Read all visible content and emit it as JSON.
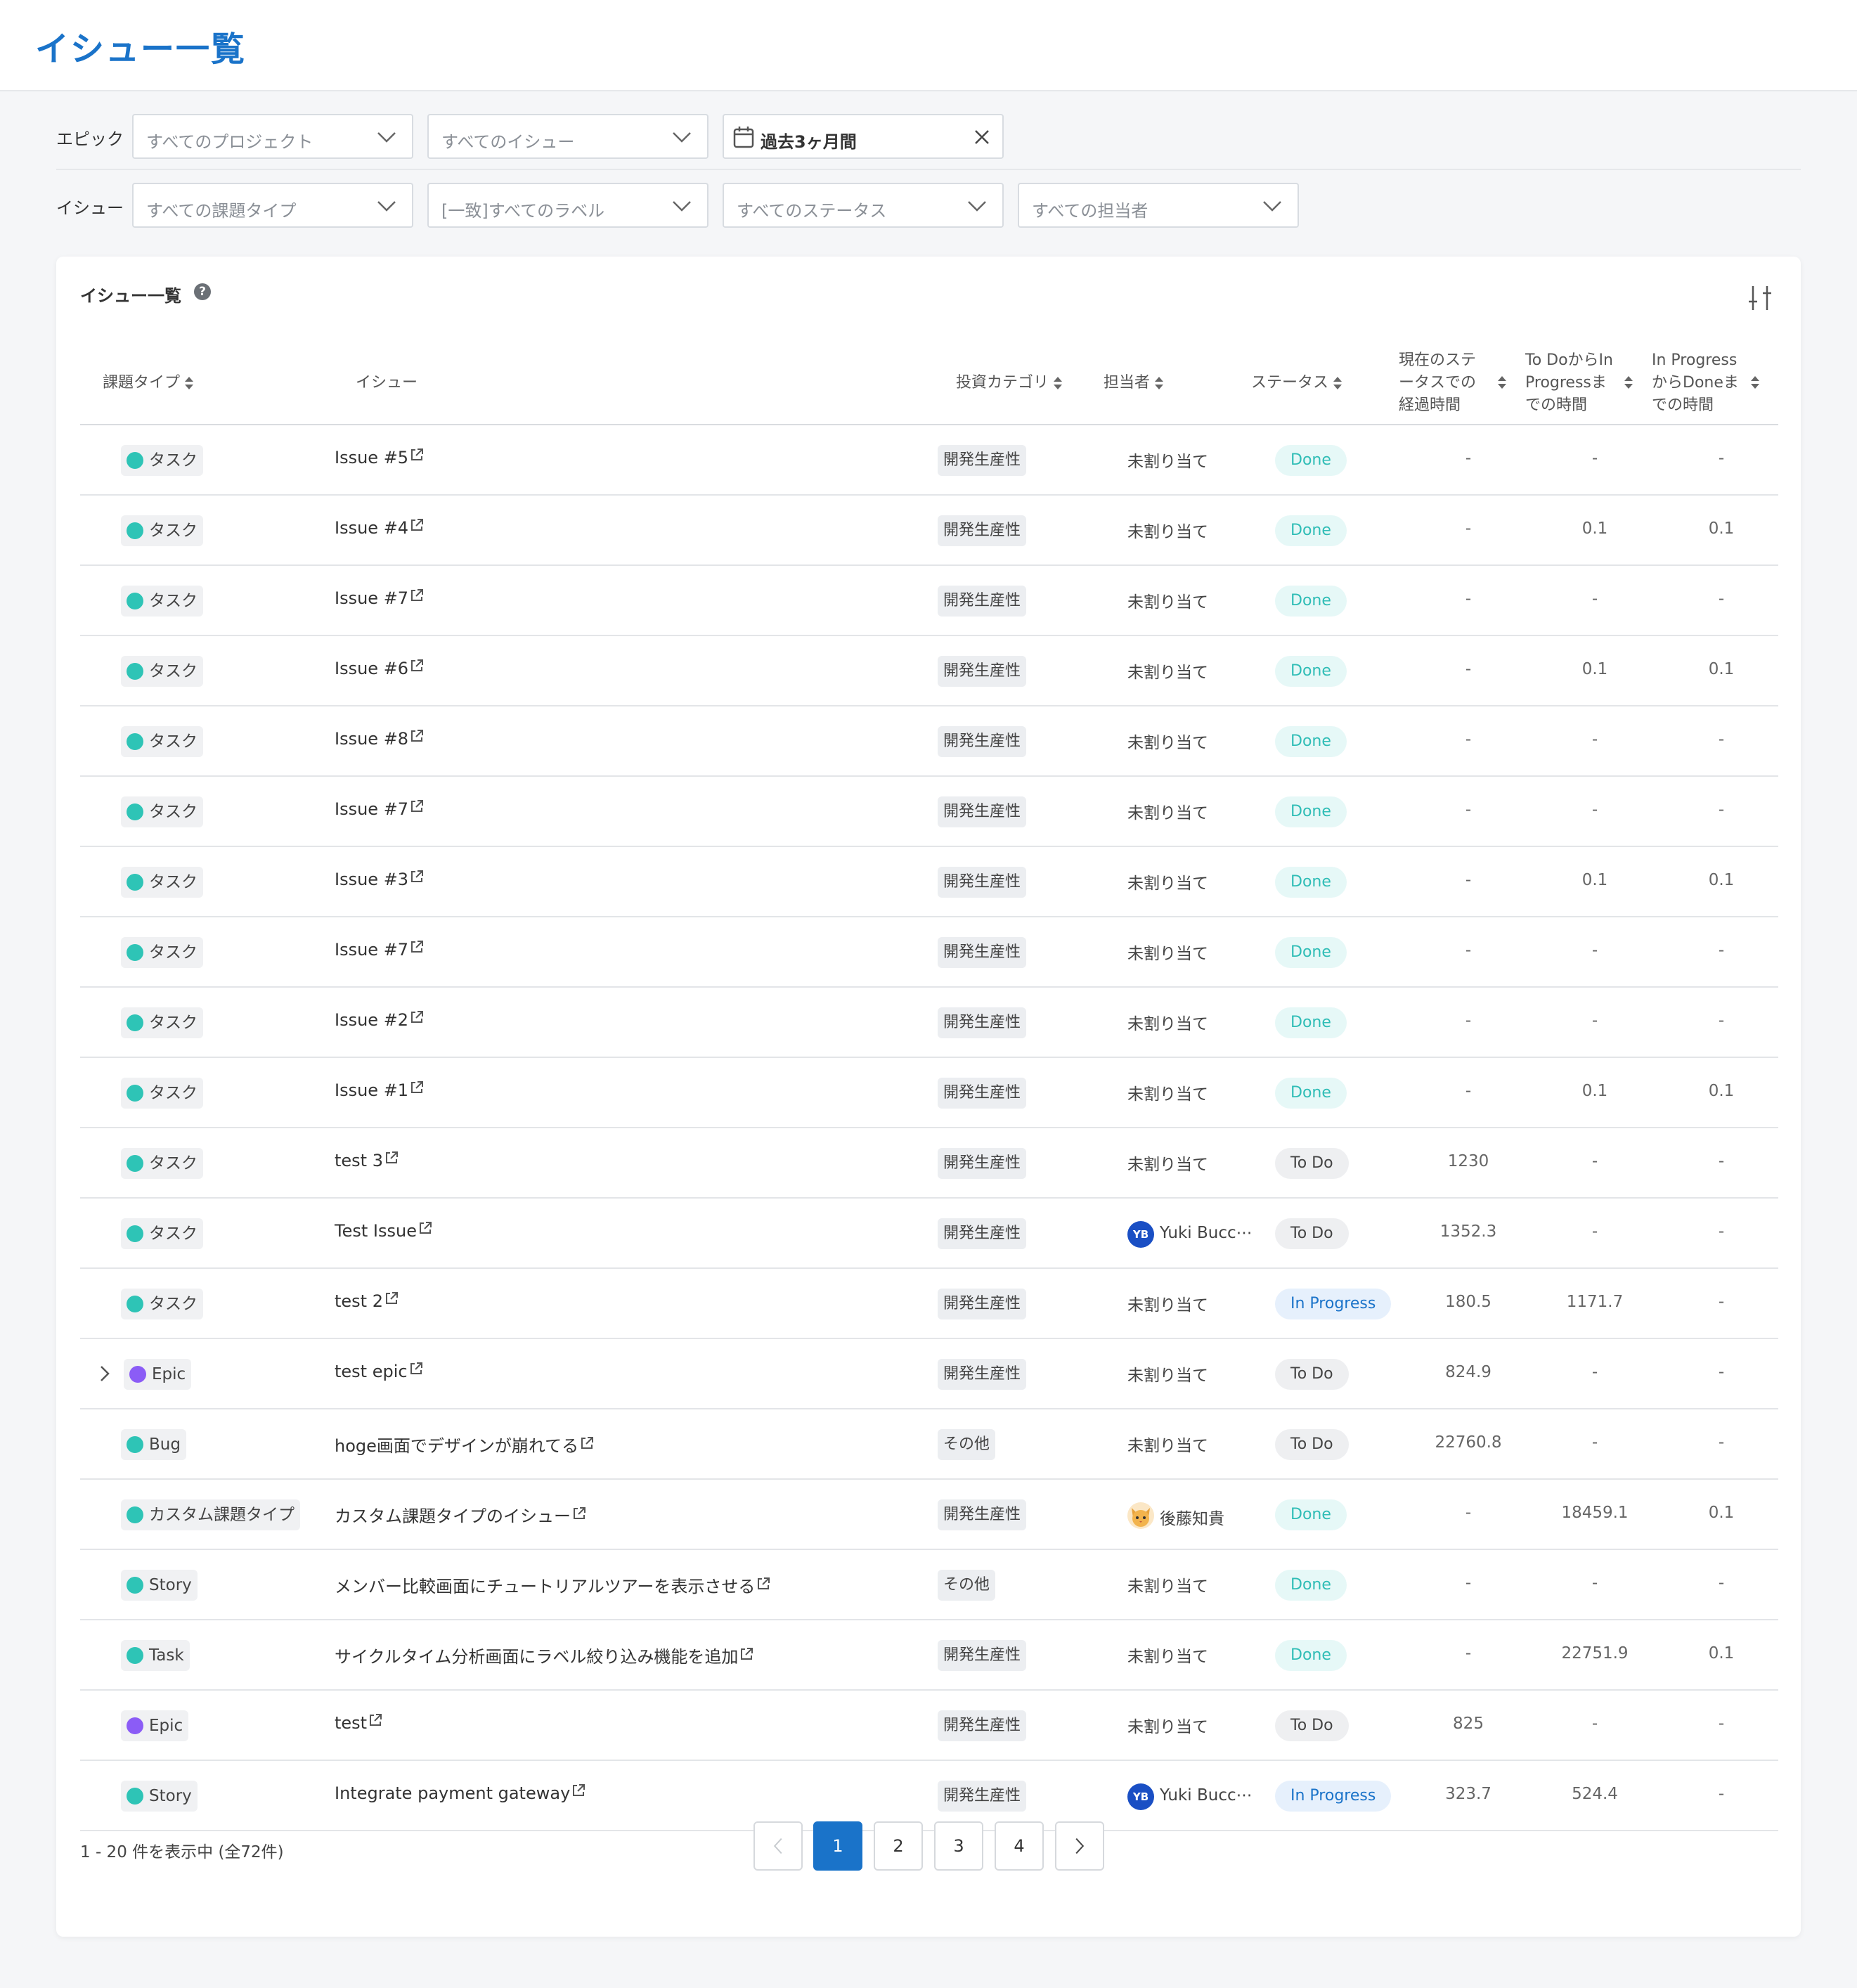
{
  "page_title": "イシュー一覧",
  "filters": {
    "epic_label": "エピック",
    "issue_label": "イシュー",
    "project_placeholder": "すべてのプロジェクト",
    "epic_issue_placeholder": "すべてのイシュー",
    "date_range_value": "過去3ヶ月間",
    "issue_type_placeholder": "すべての課題タイプ",
    "label_placeholder": "[一致]すべてのラベル",
    "status_placeholder": "すべてのステータス",
    "assignee_placeholder": "すべての担当者"
  },
  "card": {
    "title": "イシュー一覧",
    "help": "?"
  },
  "columns": {
    "type": "課題タイプ",
    "issue": "イシュー",
    "category": "投資カテゴリ",
    "assignee": "担当者",
    "status": "ステータス",
    "elapsed": "現在のステータスでの経過時間",
    "todo_to_progress": "To DoからIn Progressまでの時間",
    "progress_to_done": "In ProgressからDoneまでの時間"
  },
  "column_lines": {
    "elapsed": [
      "現在のステ",
      "ータスでの",
      "経過時間"
    ],
    "todo_to_progress": [
      "To DoからIn",
      "Progressま",
      "での時間"
    ],
    "progress_to_done": [
      "In Progress",
      "からDoneま",
      "での時間"
    ]
  },
  "rows": [
    {
      "type": "タスク",
      "type_color": "#2ec4b6",
      "issue": "Issue #5",
      "category": "開発生産性",
      "assignee": "未割り当て",
      "status": "Done",
      "elapsed": "-",
      "todo_to_progress": "-",
      "progress_to_done": "-"
    },
    {
      "type": "タスク",
      "type_color": "#2ec4b6",
      "issue": "Issue #4",
      "category": "開発生産性",
      "assignee": "未割り当て",
      "status": "Done",
      "elapsed": "-",
      "todo_to_progress": "0.1",
      "progress_to_done": "0.1"
    },
    {
      "type": "タスク",
      "type_color": "#2ec4b6",
      "issue": "Issue #7",
      "category": "開発生産性",
      "assignee": "未割り当て",
      "status": "Done",
      "elapsed": "-",
      "todo_to_progress": "-",
      "progress_to_done": "-"
    },
    {
      "type": "タスク",
      "type_color": "#2ec4b6",
      "issue": "Issue #6",
      "category": "開発生産性",
      "assignee": "未割り当て",
      "status": "Done",
      "elapsed": "-",
      "todo_to_progress": "0.1",
      "progress_to_done": "0.1"
    },
    {
      "type": "タスク",
      "type_color": "#2ec4b6",
      "issue": "Issue #8",
      "category": "開発生産性",
      "assignee": "未割り当て",
      "status": "Done",
      "elapsed": "-",
      "todo_to_progress": "-",
      "progress_to_done": "-"
    },
    {
      "type": "タスク",
      "type_color": "#2ec4b6",
      "issue": "Issue #7",
      "category": "開発生産性",
      "assignee": "未割り当て",
      "status": "Done",
      "elapsed": "-",
      "todo_to_progress": "-",
      "progress_to_done": "-"
    },
    {
      "type": "タスク",
      "type_color": "#2ec4b6",
      "issue": "Issue #3",
      "category": "開発生産性",
      "assignee": "未割り当て",
      "status": "Done",
      "elapsed": "-",
      "todo_to_progress": "0.1",
      "progress_to_done": "0.1"
    },
    {
      "type": "タスク",
      "type_color": "#2ec4b6",
      "issue": "Issue #7",
      "category": "開発生産性",
      "assignee": "未割り当て",
      "status": "Done",
      "elapsed": "-",
      "todo_to_progress": "-",
      "progress_to_done": "-"
    },
    {
      "type": "タスク",
      "type_color": "#2ec4b6",
      "issue": "Issue #2",
      "category": "開発生産性",
      "assignee": "未割り当て",
      "status": "Done",
      "elapsed": "-",
      "todo_to_progress": "-",
      "progress_to_done": "-"
    },
    {
      "type": "タスク",
      "type_color": "#2ec4b6",
      "issue": "Issue #1",
      "category": "開発生産性",
      "assignee": "未割り当て",
      "status": "Done",
      "elapsed": "-",
      "todo_to_progress": "0.1",
      "progress_to_done": "0.1"
    },
    {
      "type": "タスク",
      "type_color": "#2ec4b6",
      "issue": "test 3",
      "category": "開発生産性",
      "assignee": "未割り当て",
      "status": "To Do",
      "elapsed": "1230",
      "todo_to_progress": "-",
      "progress_to_done": "-"
    },
    {
      "type": "タスク",
      "type_color": "#2ec4b6",
      "issue": "Test Issue",
      "category": "開発生産性",
      "assignee": "Yuki Bucc⋯",
      "avatar": "YB",
      "status": "To Do",
      "elapsed": "1352.3",
      "todo_to_progress": "-",
      "progress_to_done": "-"
    },
    {
      "type": "タスク",
      "type_color": "#2ec4b6",
      "issue": "test 2",
      "category": "開発生産性",
      "assignee": "未割り当て",
      "status": "In Progress",
      "elapsed": "180.5",
      "todo_to_progress": "1171.7",
      "progress_to_done": "-"
    },
    {
      "type": "Epic",
      "type_color": "#8b5cf6",
      "expandable": true,
      "issue": "test epic",
      "category": "開発生産性",
      "assignee": "未割り当て",
      "status": "To Do",
      "elapsed": "824.9",
      "todo_to_progress": "-",
      "progress_to_done": "-"
    },
    {
      "type": "Bug",
      "type_color": "#2ec4b6",
      "issue": "hoge画面でデザインが崩れてる",
      "category": "その他",
      "assignee": "未割り当て",
      "status": "To Do",
      "elapsed": "22760.8",
      "todo_to_progress": "-",
      "progress_to_done": "-"
    },
    {
      "type": "カスタム課題タイプ",
      "type_color": "#2ec4b6",
      "issue": "カスタム課題タイプのイシュー",
      "category": "開発生産性",
      "assignee": "後藤知貴",
      "avatar_cat": true,
      "status": "Done",
      "elapsed": "-",
      "todo_to_progress": "18459.1",
      "progress_to_done": "0.1"
    },
    {
      "type": "Story",
      "type_color": "#2ec4b6",
      "issue": "メンバー比較画面にチュートリアルツアーを表示させる",
      "category": "その他",
      "assignee": "未割り当て",
      "status": "Done",
      "elapsed": "-",
      "todo_to_progress": "-",
      "progress_to_done": "-"
    },
    {
      "type": "Task",
      "type_color": "#2ec4b6",
      "issue": "サイクルタイム分析画面にラベル絞り込み機能を追加",
      "category": "開発生産性",
      "assignee": "未割り当て",
      "status": "Done",
      "elapsed": "-",
      "todo_to_progress": "22751.9",
      "progress_to_done": "0.1"
    },
    {
      "type": "Epic",
      "type_color": "#8b5cf6",
      "issue": "test",
      "category": "開発生産性",
      "assignee": "未割り当て",
      "status": "To Do",
      "elapsed": "825",
      "todo_to_progress": "-",
      "progress_to_done": "-"
    },
    {
      "type": "Story",
      "type_color": "#2ec4b6",
      "issue": "Integrate payment gateway",
      "category": "開発生産性",
      "assignee": "Yuki Bucc⋯",
      "avatar": "YB",
      "status": "In Progress",
      "elapsed": "323.7",
      "todo_to_progress": "524.4",
      "progress_to_done": "-"
    }
  ],
  "pagination": {
    "info": "1 - 20 件を表示中 (全72件)",
    "pages": [
      "1",
      "2",
      "3",
      "4"
    ],
    "current": "1"
  },
  "icons": {
    "sort": "sort-icon",
    "external": "external-link-icon",
    "chevron": "chevron-down-icon",
    "calendar": "calendar-icon",
    "clear": "close-icon",
    "settings": "column-settings-icon"
  }
}
